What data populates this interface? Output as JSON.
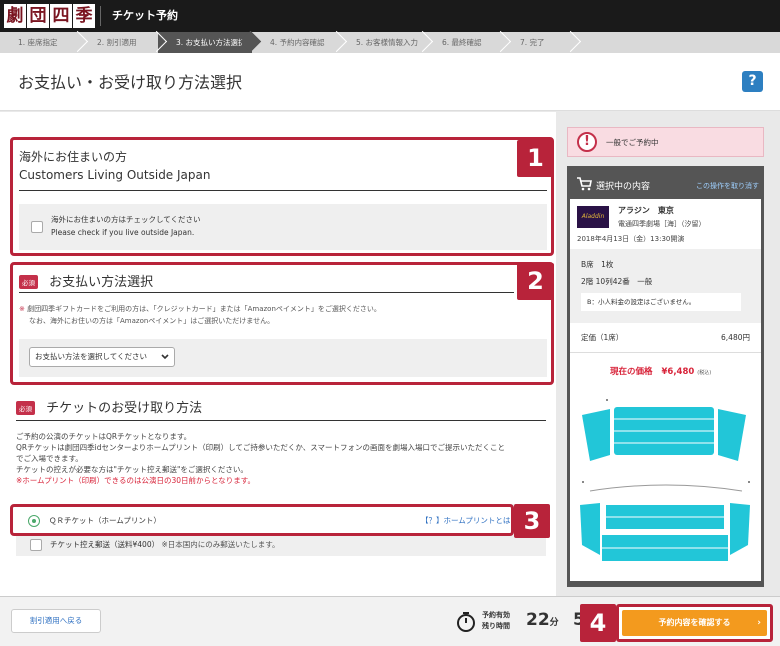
{
  "app": {
    "logo_chars": [
      "劇",
      "団",
      "四",
      "季"
    ],
    "title": "チケット予約"
  },
  "steps": [
    "1. 座席指定",
    "2. 割引適用",
    "3. お支払い方法選択",
    "4. 予約内容確認",
    "5. お客様情報入力",
    "6. 最終確認",
    "7. 完了"
  ],
  "page": {
    "title": "お支払い・お受け取り方法選択",
    "help_label": "?"
  },
  "section1": {
    "number": "1",
    "title_ja": "海外にお住まいの方",
    "title_en": "Customers Living Outside Japan",
    "check_ja": "海外にお住まいの方はチェックしてください",
    "check_en": "Please check if you live outside Japan."
  },
  "section2": {
    "number": "2",
    "required": "必須",
    "title": "お支払い方法選択",
    "note_mark": "※",
    "note_line1": "劇団四季ギフトカードをご利用の方は、「クレジットカード」または「Amazonペイメント」をご選択ください。",
    "note_line2": "なお、海外にお住いの方は「Amazonペイメント」はご選択いただけません。",
    "select_value": "お支払い方法を選択してください"
  },
  "section3": {
    "required": "必須",
    "title": "チケットのお受け取り方法",
    "desc1": "ご予約の公演のチケットはQRチケットとなります。",
    "desc2": "QRチケットは劇団四季idセンターよりホームプリント（印刷）してご持参いただくか、スマートフォンの画面を劇場入場口でご提示いただくこと",
    "desc3": "でご入場できます。",
    "desc4": "チケットの控えが必要な方は\"チケット控え郵送\"をご選択ください。",
    "warning": "※ホームプリント（印刷）できるのは公演日の30日前からとなります。",
    "number": "3",
    "option_qr": "ＱＲチケット（ホームプリント）",
    "option_qr_link": "【？】ホームプリントとは",
    "option_mail": "チケット控え郵送（送料¥400）",
    "option_mail_note": "※日本国内にのみ郵送いたします。"
  },
  "sidebar": {
    "alert": "一般でご予約中",
    "cart_title": "選択中の内容",
    "cancel_link": "この操作を取り消す",
    "show_name": "アラジン　東京",
    "venue": "電通四季劇場［海］（汐留）",
    "date": "2018年4月13日（金）13:30開演",
    "seat_type": "B席　1枚",
    "seat_no": "2階 10列42番　一般",
    "seat_note": "B：小人料金の設定はございません。",
    "price_label": "定価（1席）",
    "price_value": "6,480円",
    "current_label": "現在の価格",
    "current_value": "¥6,480",
    "tax": "(税込)",
    "poster_text": "Aladdin"
  },
  "footer": {
    "back_button": "割引適用へ戻る",
    "timer_label1": "予約有効",
    "timer_label2": "残り時間",
    "minutes": "22",
    "min_unit": "分",
    "seconds": "5",
    "number": "4",
    "confirm_button": "予約内容を確認する"
  },
  "colors": {
    "accent_red": "#b8233a",
    "confirm_orange": "#f39a1e",
    "help_blue": "#2d7fc1",
    "seat_cyan": "#22c6d8",
    "radio_green": "#4aa86a"
  }
}
